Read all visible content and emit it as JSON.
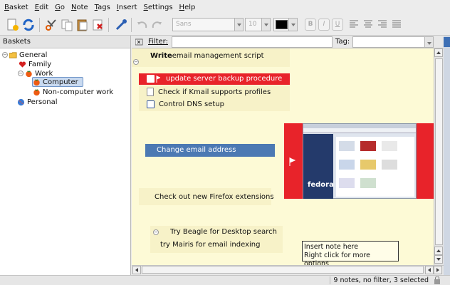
{
  "menubar": {
    "items": [
      "Basket",
      "Edit",
      "Go",
      "Note",
      "Tags",
      "Insert",
      "Settings",
      "Help"
    ]
  },
  "toolbar": {
    "font_name": "Sans",
    "font_size": "10",
    "text_color": "#000000",
    "bold_label": "B",
    "italic_label": "I",
    "underline_label": "U"
  },
  "left_panel": {
    "header": "Baskets",
    "tree": [
      {
        "label": "General",
        "icon": "folder-icon",
        "level": 0
      },
      {
        "label": "Family",
        "icon": "heart-icon",
        "level": 1
      },
      {
        "label": "Work",
        "icon": "tomato-icon",
        "level": 1
      },
      {
        "label": "Computer",
        "icon": "tomato-icon",
        "level": 2,
        "selected": true
      },
      {
        "label": "Non-computer work",
        "icon": "tomato-icon",
        "level": 2
      },
      {
        "label": "Personal",
        "icon": "globe-icon",
        "level": 1
      }
    ]
  },
  "filter_bar": {
    "filter_label": "Filter:",
    "filter_value": "",
    "tag_label": "Tag:",
    "tag_value": ""
  },
  "basket": {
    "write_bold": "Write",
    "write_rest": " email management script",
    "notes": {
      "backup": "update server backup procedure",
      "kmail": "Check if Kmail supports profiles",
      "dns": "Control DNS setup",
      "email_addr": "Change email address",
      "firefox": "Check out new Firefox extensions",
      "beagle": "Try Beagle for Desktop search",
      "mairis": "try Mairis for email indexing"
    },
    "image_label": "fedora",
    "insert_hint": {
      "line1": "Insert note here",
      "line2": "Right click for more options"
    },
    "colors": {
      "background": "#fdfad6",
      "highlight": "#e8232a",
      "selected_note": "#4c79b3"
    }
  },
  "statusbar": {
    "text": "9 notes, no filter, 3 selected"
  }
}
